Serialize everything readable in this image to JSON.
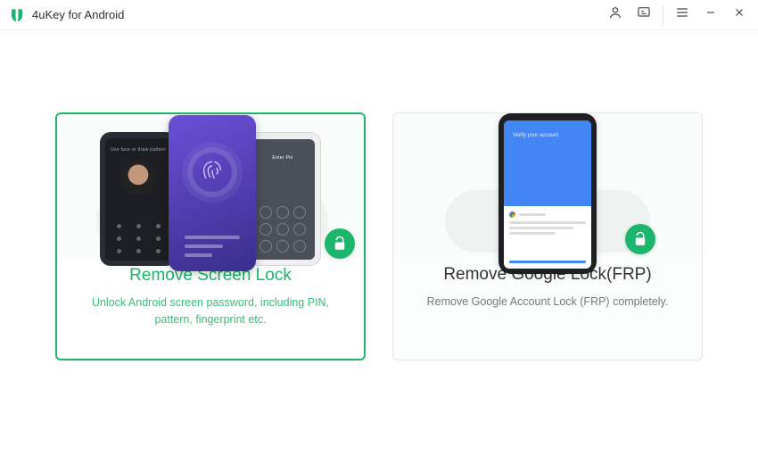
{
  "header": {
    "app_title": "4uKey for Android"
  },
  "icons": {
    "account": "account-icon",
    "feedback": "feedback-icon",
    "menu": "menu-icon",
    "minimize": "minimize-icon",
    "close": "close-icon",
    "logo": "app-logo-icon",
    "unlock": "unlock-icon",
    "fingerprint": "fingerprint-icon",
    "google": "google-icon"
  },
  "cards": {
    "screen_lock": {
      "title": "Remove Screen Lock",
      "description": "Unlock Android screen password, including PIN, pattern, fingerprint etc.",
      "selected": true,
      "illus_texts": {
        "left": "Use face or draw pattern",
        "right": "Enter Pin"
      }
    },
    "google_lock": {
      "title": "Remove Google Lock(FRP)",
      "description": "Remove Google Account Lock (FRP) completely.",
      "selected": false,
      "illus_texts": {
        "verify": "Verify your account"
      }
    }
  },
  "colors": {
    "accent": "#1bb56c",
    "google_blue": "#4285f4"
  }
}
